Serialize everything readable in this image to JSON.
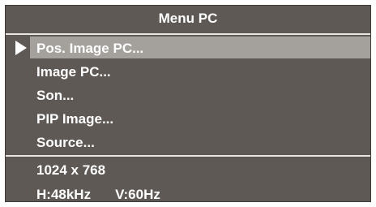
{
  "window": {
    "title": "Menu PC"
  },
  "menu": {
    "items": [
      {
        "label": "Pos. Image PC...",
        "selected": true
      },
      {
        "label": "Image PC..."
      },
      {
        "label": "Son..."
      },
      {
        "label": "PIP Image..."
      },
      {
        "label": "Source..."
      }
    ]
  },
  "info": {
    "resolution": "1024 x 768",
    "h_freq": "H:48kHz",
    "v_freq": "V:60Hz"
  },
  "colors": {
    "background": "#5f5955",
    "highlight": "#a4a09c",
    "text": "#ffffff"
  }
}
